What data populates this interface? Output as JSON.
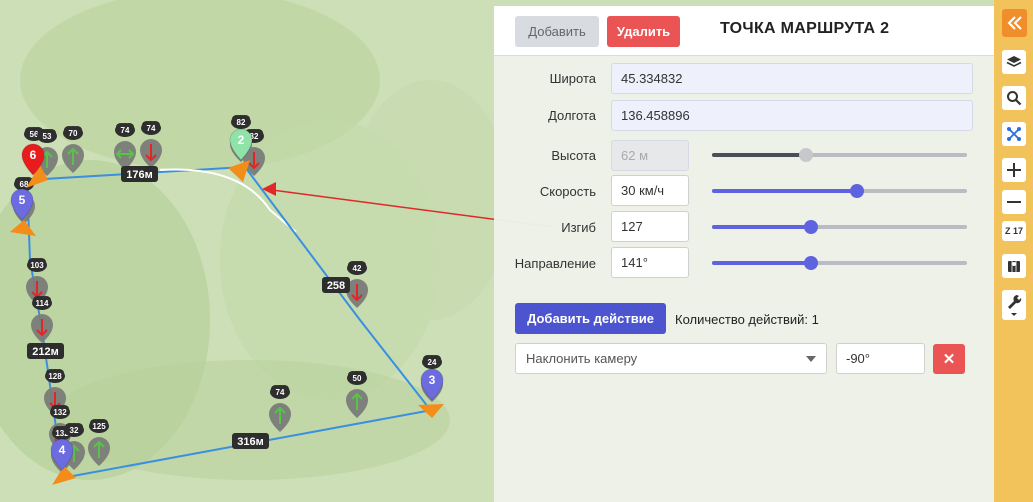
{
  "map": {
    "segments": [
      {
        "label": "176м"
      },
      {
        "label": "258"
      },
      {
        "label": "212м"
      },
      {
        "label": "316м"
      }
    ],
    "waypoints": [
      {
        "label": "2",
        "color": "#8fe3a8"
      },
      {
        "label": "3",
        "color": "#6c6ce0"
      },
      {
        "label": "4",
        "color": "#6c6ce0"
      },
      {
        "label": "5",
        "color": "#6c6ce0"
      },
      {
        "label": "6",
        "color": "#e81c1c"
      }
    ],
    "markers": [
      {
        "cloud": "56"
      },
      {
        "cloud": "53"
      },
      {
        "cloud": "70"
      },
      {
        "cloud": "74"
      },
      {
        "cloud": "74"
      },
      {
        "cloud": "82"
      },
      {
        "cloud": "82"
      },
      {
        "cloud": "68"
      },
      {
        "cloud": "103"
      },
      {
        "cloud": "114"
      },
      {
        "cloud": "128"
      },
      {
        "cloud": "132"
      },
      {
        "cloud": "132"
      },
      {
        "cloud": "32"
      },
      {
        "cloud": "125"
      },
      {
        "cloud": "74"
      },
      {
        "cloud": "50"
      },
      {
        "cloud": "42"
      },
      {
        "cloud": "24"
      }
    ]
  },
  "panel": {
    "add_label": "Добавить",
    "delete_label": "Удалить",
    "title": "ТОЧКА МАРШРУТА 2",
    "latitude_label": "Широта",
    "latitude_value": "45.334832",
    "longitude_label": "Долгота",
    "longitude_value": "136.458896",
    "height_label": "Высота",
    "height_value": "62 м",
    "height_fraction": 0.37,
    "speed_label": "Скорость",
    "speed_value": "30 км/ч",
    "speed_fraction": 0.57,
    "bend_label": "Изгиб",
    "bend_value": "127",
    "bend_fraction": 0.39,
    "direction_label": "Направление",
    "direction_value": "141°",
    "direction_fraction": 0.39,
    "add_action_label": "Добавить действие",
    "action_count_text": "Количество действий: 1",
    "action_select_value": "Наклонить камеру",
    "action_param_value": "-90°",
    "action_remove_label": "✕"
  },
  "toolbar": {
    "collapse_icon": "double-chevron-left-icon",
    "zoom_level": "Z 17",
    "accent_color": "#f2c35b"
  }
}
